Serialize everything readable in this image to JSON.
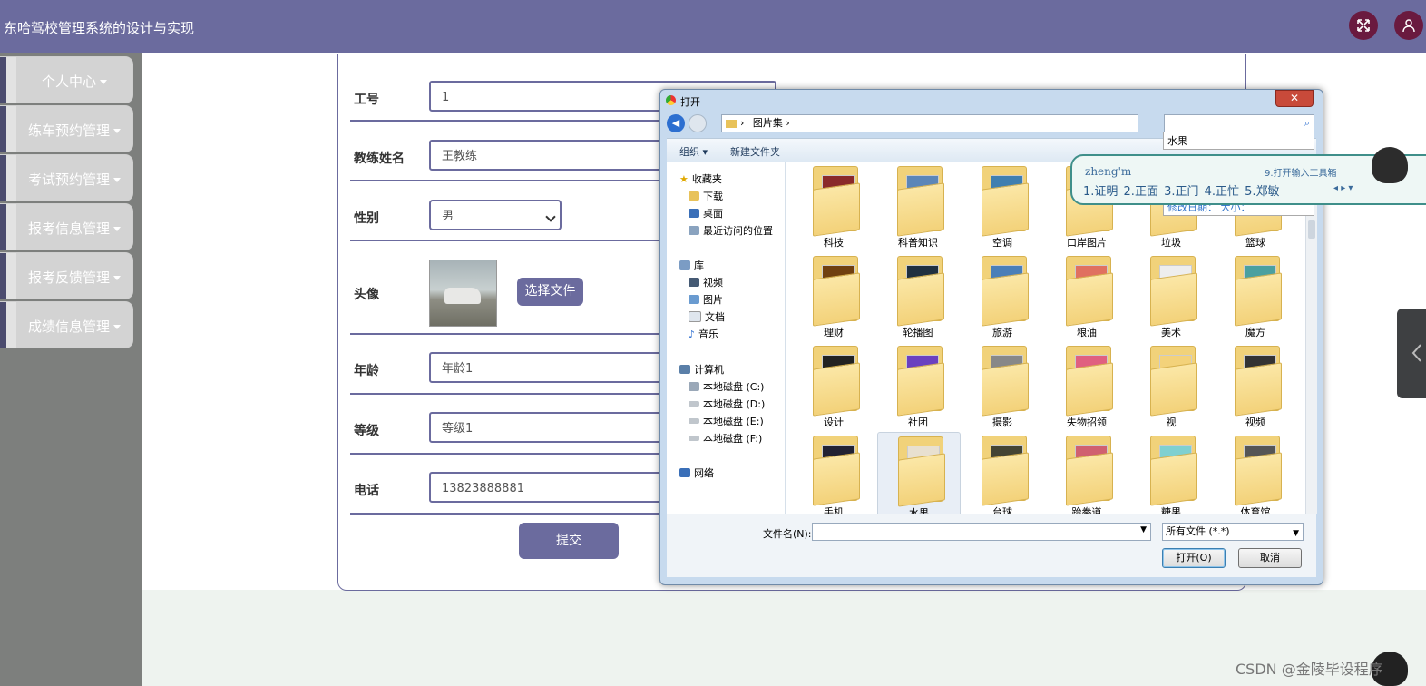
{
  "header": {
    "title": "东哈驾校管理系统的设计与实现"
  },
  "sidebar": {
    "items": [
      {
        "label": "个人中心"
      },
      {
        "label": "练车预约管理"
      },
      {
        "label": "考试预约管理"
      },
      {
        "label": "报考信息管理"
      },
      {
        "label": "报考反馈管理"
      },
      {
        "label": "成绩信息管理"
      }
    ]
  },
  "form": {
    "id_label": "工号",
    "id_value": "1",
    "name_label": "教练姓名",
    "name_value": "王教练",
    "gender_label": "性别",
    "gender_value": "男",
    "avatar_label": "头像",
    "choose_file": "选择文件",
    "age_label": "年龄",
    "age_value": "年龄1",
    "level_label": "等级",
    "level_value": "等级1",
    "phone_label": "电话",
    "phone_value": "13823888881",
    "submit": "提交"
  },
  "dialog": {
    "title": "打开",
    "close": "✕",
    "path": "图片集",
    "organize": "组织 ▾",
    "new_folder": "新建文件夹",
    "nav": {
      "favorites": "收藏夹",
      "downloads": "下载",
      "desktop": "桌面",
      "recent": "最近访问的位置",
      "library": "库",
      "videos": "视频",
      "pictures": "图片",
      "documents": "文档",
      "music": "音乐",
      "computer": "计算机",
      "drive_c": "本地磁盘 (C:)",
      "drive_d": "本地磁盘 (D:)",
      "drive_e": "本地磁盘 (E:)",
      "drive_f": "本地磁盘 (F:)",
      "network": "网络"
    },
    "folders": [
      "科技",
      "科普知识",
      "空调",
      "口岸图片",
      "垃圾",
      "篮球",
      "理财",
      "轮播图",
      "旅游",
      "粮油",
      "美术",
      "魔方",
      "设计",
      "社团",
      "摄影",
      "失物招领",
      "视",
      "视频",
      "手机",
      "水果",
      "台球",
      "跆拳道",
      "糖果",
      "体育馆"
    ],
    "selected_folder": "水果",
    "filename_label": "文件名(N):",
    "filetype": "所有文件 (*.*)",
    "open_button": "打开(O)",
    "cancel_button": "取消"
  },
  "search_suggestion": "水果",
  "search_suggestion_2": "修改日期：  大小：",
  "ime": {
    "composition": "zheng'm",
    "toolbox": "9.打开输入工具箱",
    "candidates": "1.证明  2.正面  3.正门  4.正忙  5.郑敏",
    "nav": "◂ ▸ ▾"
  },
  "watermark": "CSDN @金陵毕设程序"
}
